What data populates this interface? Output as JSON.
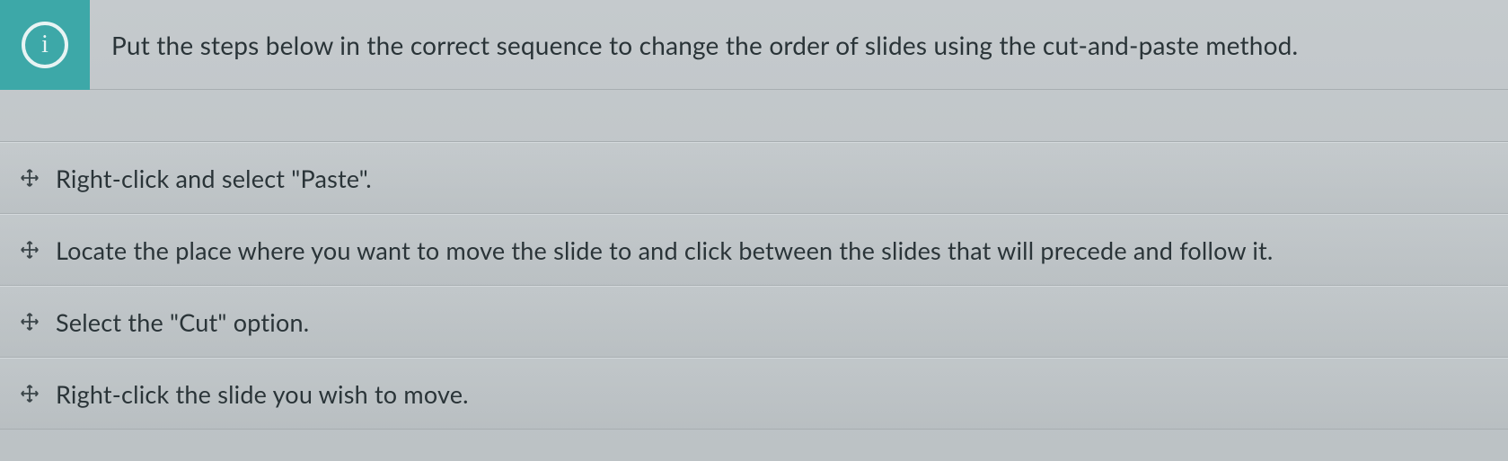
{
  "instruction": "Put the steps below in the correct sequence to change the order of slides using the cut-and-paste method.",
  "steps": [
    {
      "text": "Right-click and select \"Paste\"."
    },
    {
      "text": "Locate the place where you want to move the slide to and click between the slides that will precede and follow it."
    },
    {
      "text": "Select the \"Cut\" option."
    },
    {
      "text": "Right-click the slide you wish to move."
    }
  ],
  "info_letter": "i"
}
